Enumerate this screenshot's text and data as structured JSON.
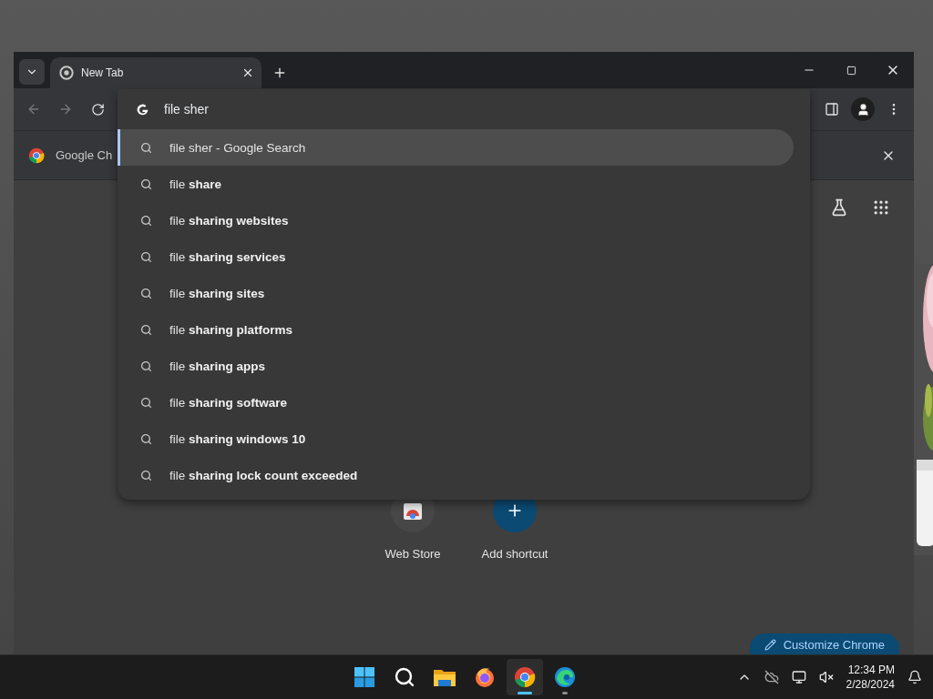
{
  "window": {
    "tabs": [
      {
        "label": "New Tab",
        "selected": true
      }
    ]
  },
  "omnibox": {
    "value": "file sher"
  },
  "suggestions": [
    {
      "text": "file sher - Google Search",
      "selected": true
    },
    {
      "text": "file **share**",
      "selected": false
    },
    {
      "text": "file **sharing websites**",
      "selected": false
    },
    {
      "text": "file **sharing services**",
      "selected": false
    },
    {
      "text": "file **sharing sites**",
      "selected": false
    },
    {
      "text": "file **sharing platforms**",
      "selected": false
    },
    {
      "text": "file **sharing apps**",
      "selected": false
    },
    {
      "text": "file **sharing software**",
      "selected": false
    },
    {
      "text": "file **sharing windows 10**",
      "selected": false
    },
    {
      "text": "file **sharing lock count exceeded**",
      "selected": false
    }
  ],
  "infobar": {
    "text": "Google Ch"
  },
  "shortcuts": [
    {
      "label": "Web Store",
      "kind": "store"
    },
    {
      "label": "Add shortcut",
      "kind": "add"
    }
  ],
  "customize_button": "Customize Chrome",
  "taskbar": {
    "apps": [
      {
        "kind": "start",
        "selected": false,
        "running": false
      },
      {
        "kind": "search",
        "selected": false,
        "running": false
      },
      {
        "kind": "files",
        "selected": false,
        "running": false
      },
      {
        "kind": "firefox",
        "selected": false,
        "running": false
      },
      {
        "kind": "chrome",
        "selected": true,
        "running": true
      },
      {
        "kind": "edge",
        "selected": false,
        "running": true
      }
    ],
    "time": "12:34 PM",
    "date": "2/28/2024"
  }
}
